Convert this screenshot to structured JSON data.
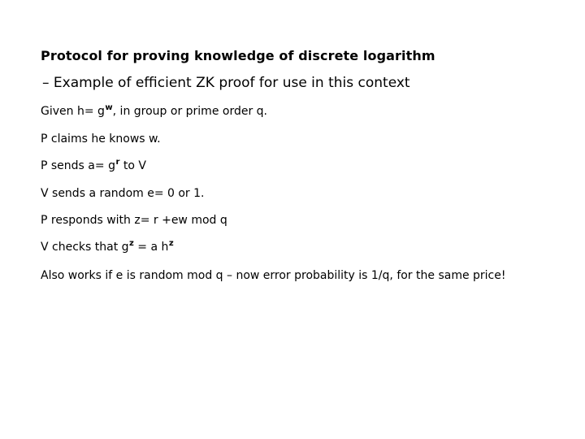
{
  "slide": {
    "title": "Protocol for proving knowledge of discrete logarithm",
    "subtitle": "– Example of efficient ZK proof for use in this context",
    "lines": [
      {
        "id": "given",
        "pre": "Given h= g",
        "sup": "w",
        "post": ", in group or prime order q."
      },
      {
        "id": "p-claims",
        "pre": "P claims he knows w.",
        "sup": "",
        "post": ""
      },
      {
        "id": "p-sends",
        "pre": "P sends a= g",
        "sup": "r",
        "post": " to V"
      },
      {
        "id": "v-sends",
        "pre": "V sends a random e= 0 or 1.",
        "sup": "",
        "post": ""
      },
      {
        "id": "p-responds",
        "pre": "P responds with z= r +ew mod q",
        "sup": "",
        "post": ""
      },
      {
        "id": "v-checks",
        "pre": "V checks that g",
        "sup": "z",
        "post": " = a h",
        "sup2": "z",
        "post2": ""
      }
    ],
    "closing_paragraph": "Also works if e is random mod q – now error probability is 1/q, for the same price!",
    "colors": {
      "background": "#ffffff",
      "text": "#000000"
    }
  }
}
